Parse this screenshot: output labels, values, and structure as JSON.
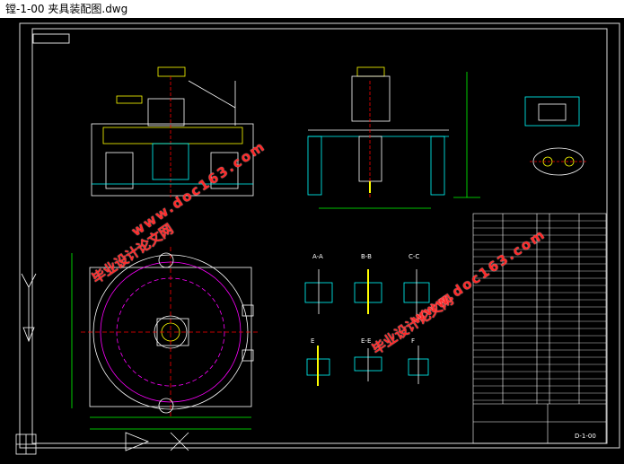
{
  "window": {
    "title": "镗-1-00 夹具装配图.dwg"
  },
  "drawing": {
    "title_block_code": "D-1-00",
    "watermarks": [
      "毕业设计论文网",
      "www.doc163.com"
    ],
    "section_labels": [
      "A-A",
      "B-B",
      "C-C",
      "E",
      "E-E",
      "F"
    ],
    "colors": {
      "background": "#000000",
      "border": "#ffffff",
      "geometry": "#ffffff",
      "hatch": "#00ffff",
      "circles": "#ff00ff",
      "dimensions": "#00ff00",
      "accent": "#ffff00",
      "watermark": "#ff2a2a"
    }
  }
}
